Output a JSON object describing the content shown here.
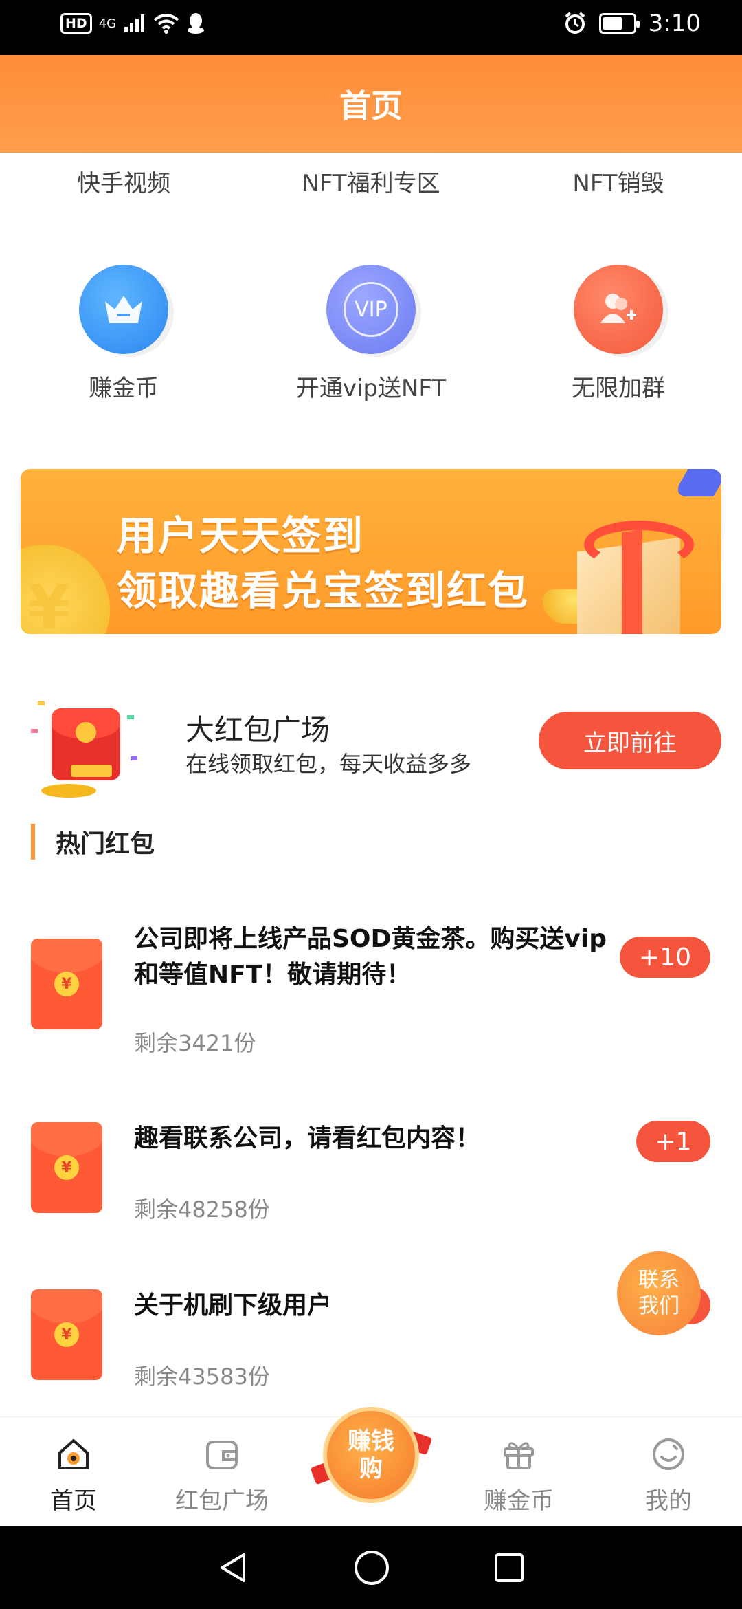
{
  "status_bar": {
    "network": "4G",
    "hd": "HD",
    "time": "3:10",
    "battery_level": 0.65
  },
  "header": {
    "title": "首页"
  },
  "top_tabs": [
    "快手视频",
    "NFT福利专区",
    "NFT销毁"
  ],
  "grid": [
    {
      "label": "赚金币",
      "icon": "crown-icon"
    },
    {
      "label": "开通vip送NFT",
      "icon": "vip-icon",
      "icon_text": "VIP"
    },
    {
      "label": "无限加群",
      "icon": "add-user-icon"
    }
  ],
  "banner": {
    "line1": "用户天天签到",
    "line2": "领取趣看兑宝签到红包"
  },
  "plaza": {
    "title": "大红包广场",
    "subtitle": "在线领取红包，每天收益多多",
    "button": "立即前往"
  },
  "section": {
    "title": "热门红包"
  },
  "packets": [
    {
      "title": "公司即将上线产品SOD黄金茶。购买送vip和等值NFT！敬请期待！",
      "remaining": "剩余3421份",
      "reward": "+10"
    },
    {
      "title": "趣看联系公司，请看红包内容！",
      "remaining": "剩余48258份",
      "reward": "+1"
    },
    {
      "title": "关于机刷下级用户",
      "remaining": "剩余43583份",
      "reward": ""
    }
  ],
  "envelope_symbol": "¥",
  "contact": {
    "line1": "联系",
    "line2": "我们"
  },
  "bottom_nav": {
    "home": "首页",
    "plaza": "红包广场",
    "center_line1": "赚钱",
    "center_line2": "购",
    "coins": "赚金币",
    "mine": "我的"
  },
  "colors": {
    "header": "#ff8c3a",
    "accent_red": "#f5553c",
    "banner": "#ffa83a"
  }
}
